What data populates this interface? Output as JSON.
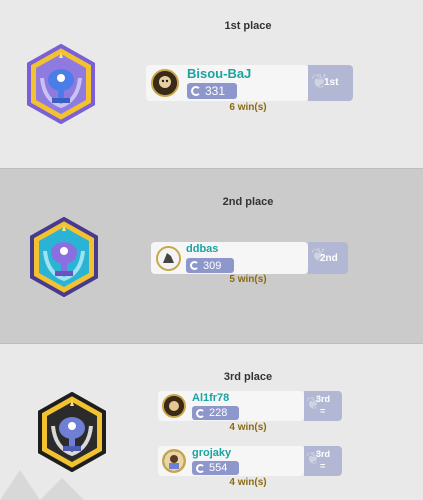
{
  "places": [
    {
      "title": "1st place",
      "players": [
        {
          "name": "Bisou-BaJ",
          "elo": "331",
          "rank": "1st",
          "wins": "6 win(s)"
        }
      ]
    },
    {
      "title": "2nd place",
      "players": [
        {
          "name": "ddbas",
          "elo": "309",
          "rank": "2nd",
          "wins": "5 win(s)"
        }
      ]
    },
    {
      "title": "3rd place",
      "players": [
        {
          "name": "Al1fr78",
          "elo": "228",
          "rank": "3rd",
          "rank_sub": "=",
          "wins": "4 win(s)"
        },
        {
          "name": "grojaky",
          "elo": "554",
          "rank": "3rd",
          "rank_sub": "=",
          "wins": "4 win(s)"
        }
      ]
    }
  ],
  "colors": {
    "player_name": "#1aa3a0",
    "elo_badge": "#8e97cb",
    "wins_text": "#8b6b10",
    "rank_tab": "#b2b8d3",
    "band_light": "#e9e9e9",
    "band_dark": "#cbcbcb"
  },
  "icons": [
    "trophy-gold-badge-icon",
    "trophy-silver-badge-icon",
    "trophy-bronze-badge-icon",
    "elo-ring-icon",
    "laurel-icon",
    "avatar-icon"
  ]
}
